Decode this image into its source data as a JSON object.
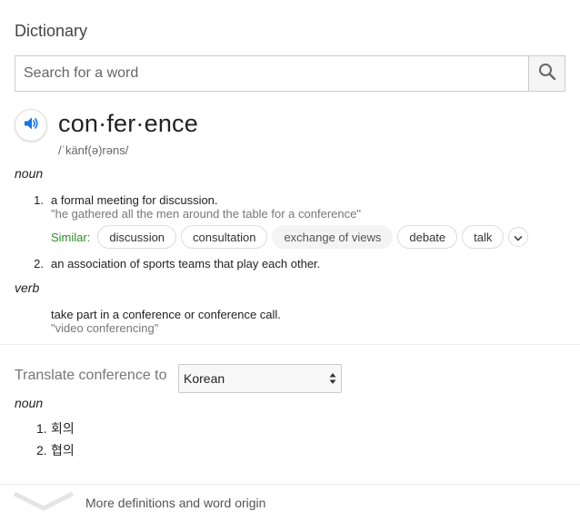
{
  "app": {
    "title": "Dictionary"
  },
  "search": {
    "placeholder": "Search for a word",
    "value": ""
  },
  "entry": {
    "headword": "con·fer·ence",
    "pronunciation": "/ˈkänf(ə)rəns/",
    "noun_label": "noun",
    "senses": [
      {
        "number": "1.",
        "definition": "a formal meeting for discussion.",
        "example": "\"he gathered all the men around the table for a conference\""
      },
      {
        "number": "2.",
        "definition": "an association of sports teams that play each other."
      }
    ],
    "similar_label": "Similar:",
    "similar": [
      "discussion",
      "consultation",
      "exchange of views",
      "debate",
      "talk"
    ],
    "verb_label": "verb",
    "verb_sense": {
      "definition": "take part in a conference or conference call.",
      "example": "\"video conferencing\""
    }
  },
  "translate": {
    "label": "Translate conference to",
    "language": "Korean",
    "pos_label": "noun",
    "items": [
      {
        "number": "1.",
        "text": "회의"
      },
      {
        "number": "2.",
        "text": "협의"
      }
    ]
  },
  "footer": {
    "more_label": "More definitions and word origin"
  },
  "icons": {
    "search": "search-icon",
    "speaker": "speaker-icon",
    "expand": "chevron-down-icon",
    "select": "select-arrows-icon",
    "more": "chevron-down-icon"
  },
  "colors": {
    "accent": "#1a73e8",
    "similar_label": "#2a8f2a"
  }
}
